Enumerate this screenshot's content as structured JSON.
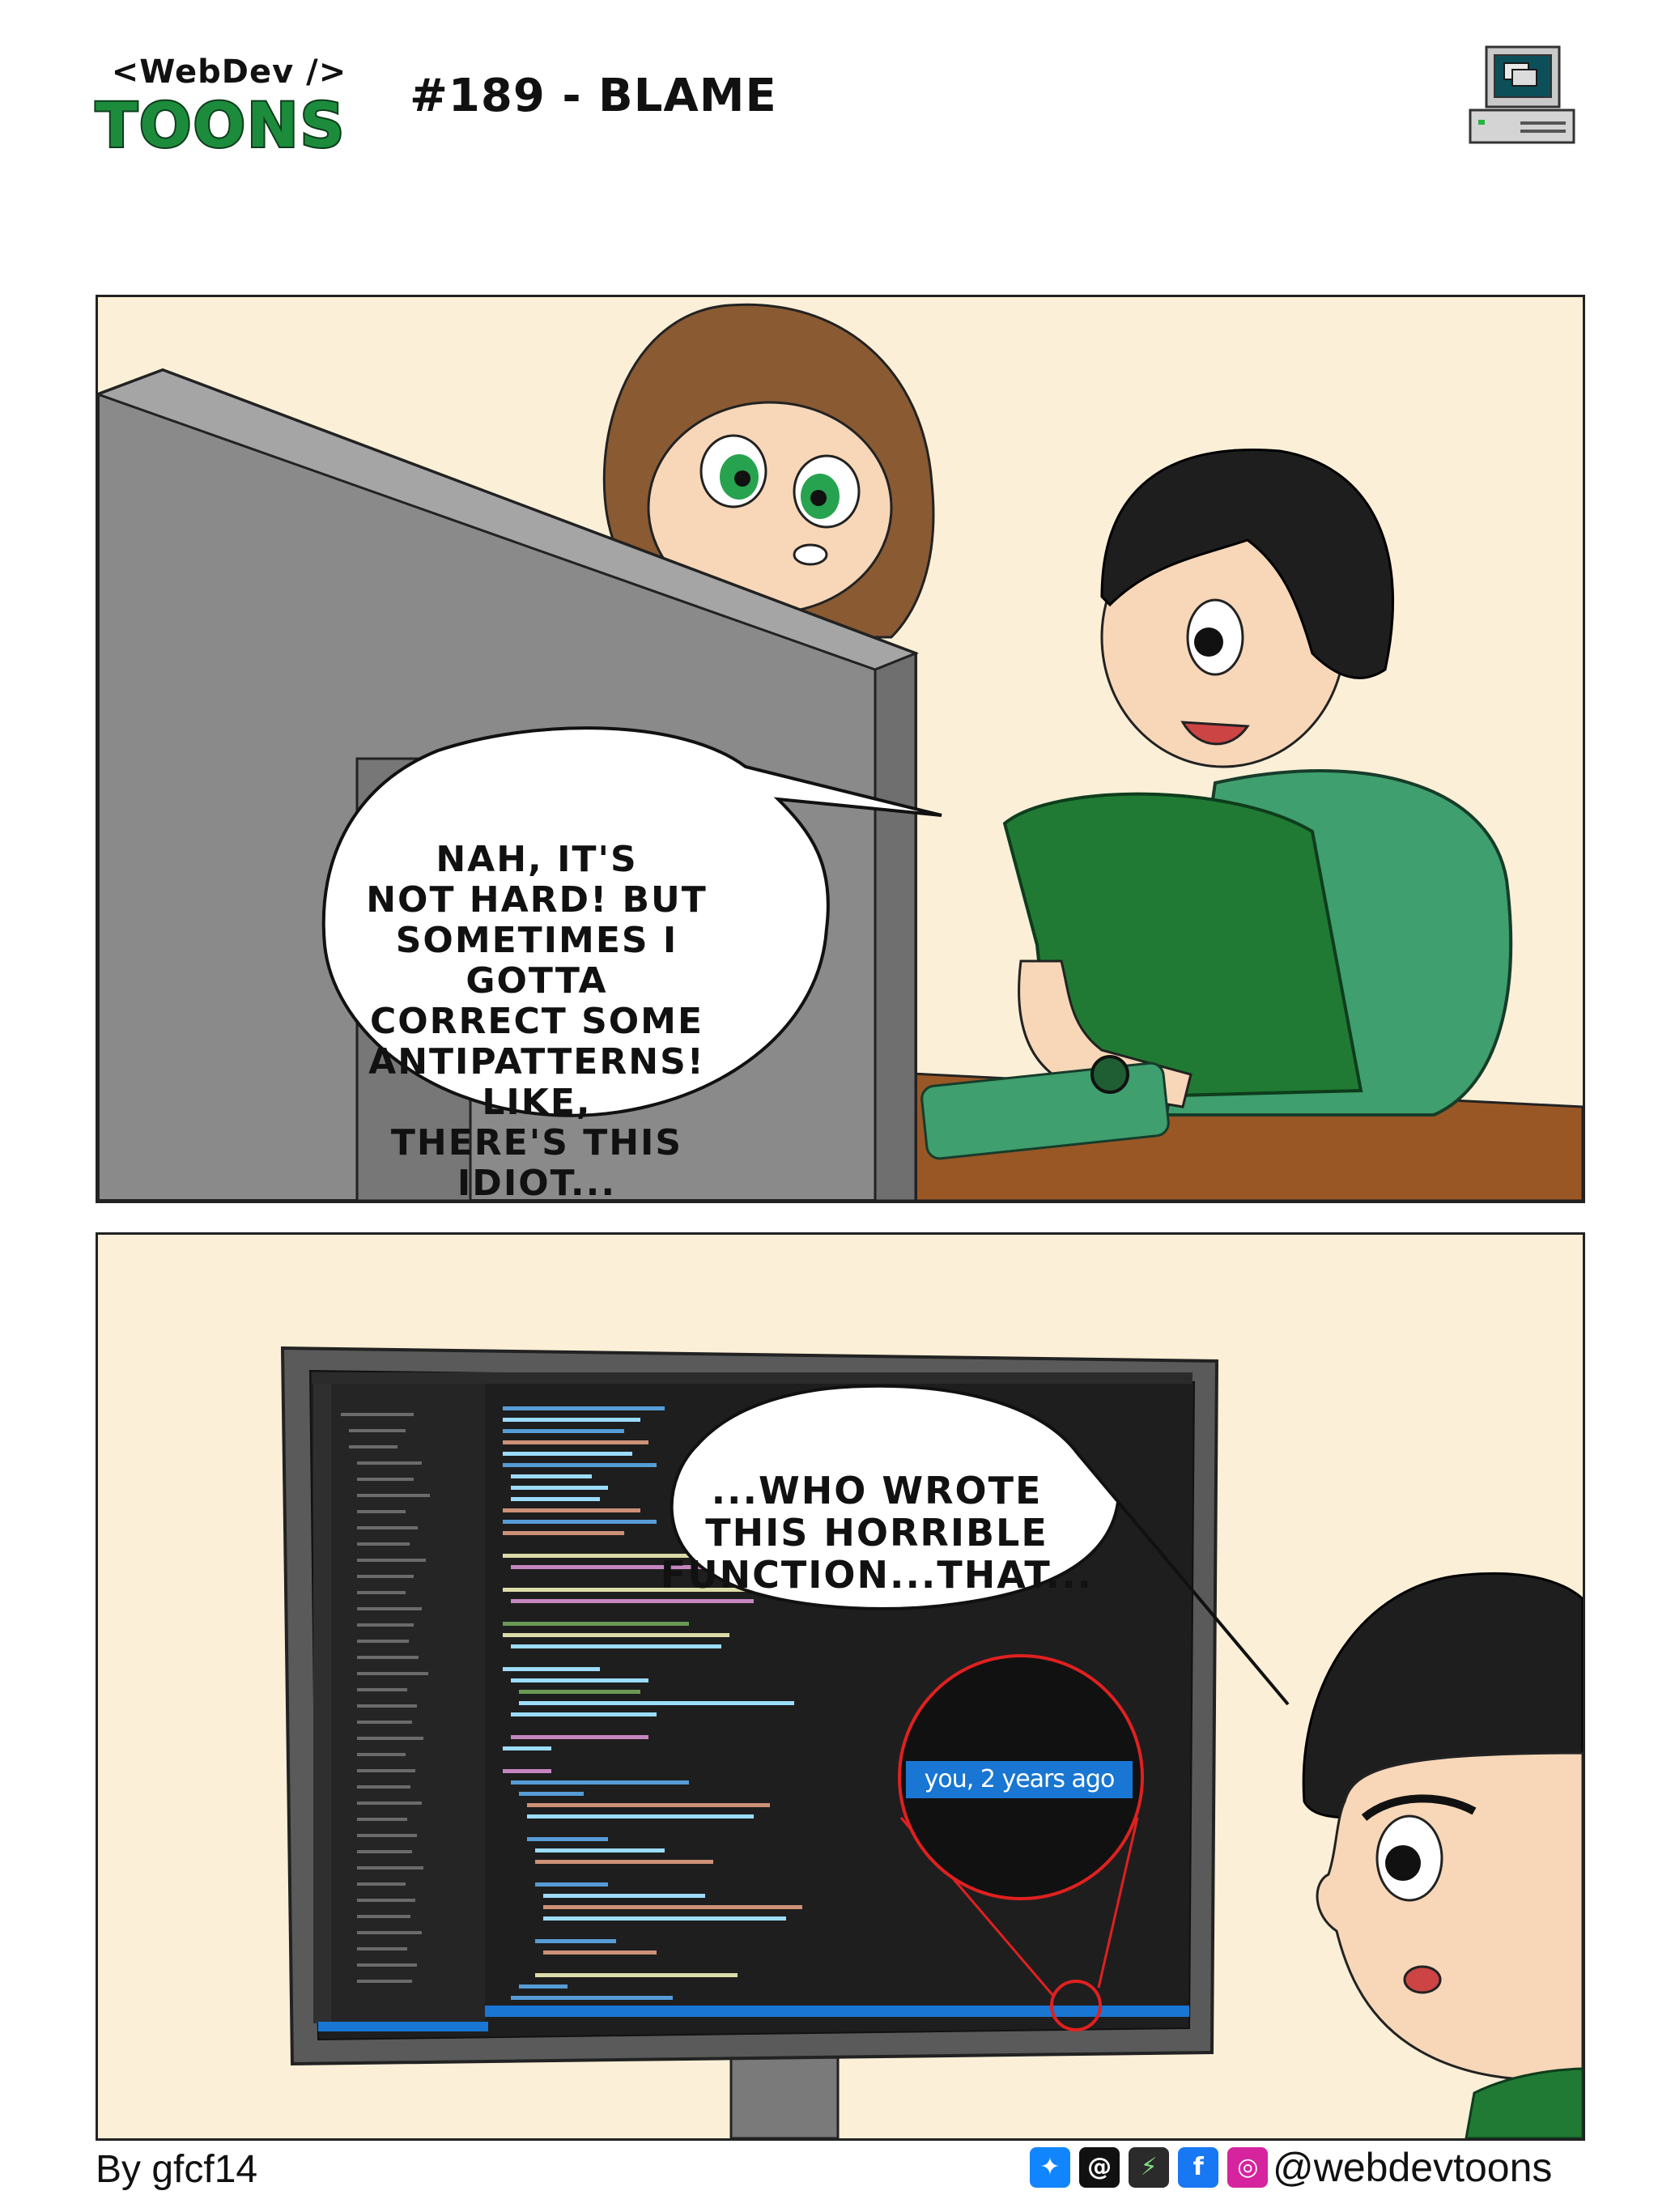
{
  "header": {
    "logo_top": "<WebDev />",
    "logo_bottom": "TOONS",
    "episode_title": "#189 - BLAME"
  },
  "panel_1": {
    "speech": "NAH, IT'S\nNOT HARD! BUT\nSOMETIMES I GOTTA\nCORRECT SOME\nANTIPATTERNS! LIKE,\nTHERE'S THIS\nIDIOT..."
  },
  "panel_2": {
    "speech": "...WHO WROTE\nTHIS HORRIBLE\nFUNCTION...THAT...",
    "blame_annotation": "you, 2 years ago"
  },
  "footer": {
    "credit": "By gfcf14",
    "handle": "@webdevtoons",
    "social_icons": [
      "bluesky-icon",
      "threads-icon",
      "spacehey-icon",
      "facebook-icon",
      "instagram-icon"
    ]
  },
  "colors": {
    "panel_bg": "#fbefd7",
    "logo_green": "#1c8c3c",
    "shirt_green": "#207a33",
    "chair_green": "#3f9f6e",
    "desk_brown": "#9a5726",
    "blame_blue": "#1976d2",
    "magnifier_red": "#e02020"
  }
}
